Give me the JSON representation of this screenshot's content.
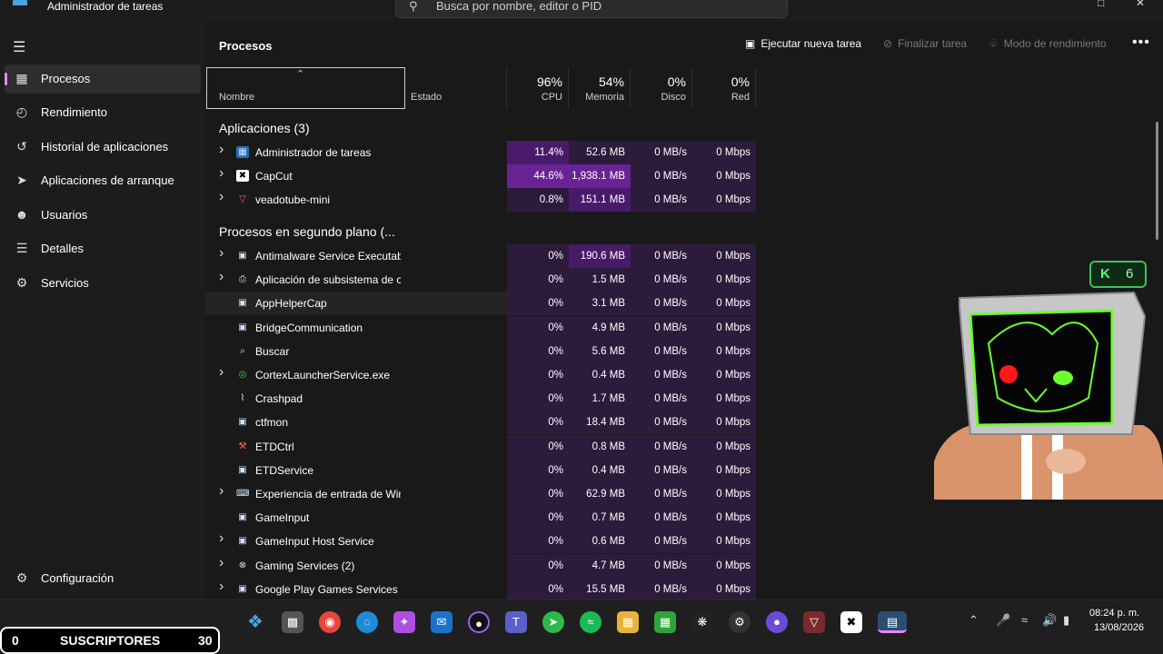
{
  "window": {
    "title": "Administrador de tareas",
    "search_placeholder": "Busca por nombre, editor o PID"
  },
  "sidebar": {
    "items": [
      {
        "label": "Procesos",
        "icon": "processes-icon"
      },
      {
        "label": "Rendimiento",
        "icon": "performance-icon"
      },
      {
        "label": "Historial de aplicaciones",
        "icon": "history-icon"
      },
      {
        "label": "Aplicaciones de arranque",
        "icon": "startup-icon"
      },
      {
        "label": "Usuarios",
        "icon": "users-icon"
      },
      {
        "label": "Detalles",
        "icon": "details-icon"
      },
      {
        "label": "Servicios",
        "icon": "services-icon"
      }
    ],
    "settings_label": "Configuración"
  },
  "toolbar": {
    "title": "Procesos",
    "run_task": "Ejecutar nueva tarea",
    "end_task": "Finalizar tarea",
    "efficiency": "Modo de rendimiento"
  },
  "columns": {
    "name": "Nombre",
    "status": "Estado",
    "cpu": {
      "pct": "96%",
      "label": "CPU"
    },
    "memory": {
      "pct": "54%",
      "label": "Memoria"
    },
    "disk": {
      "pct": "0%",
      "label": "Disco"
    },
    "network": {
      "pct": "0%",
      "label": "Red"
    }
  },
  "groups": {
    "apps": "Aplicaciones (3)",
    "background": "Procesos en segundo plano (..."
  },
  "apps": [
    {
      "name": "Administrador de tareas",
      "cpu": "11.4%",
      "mem": "52.6 MB",
      "disk": "0 MB/s",
      "net": "0 Mbps"
    },
    {
      "name": "CapCut",
      "cpu": "44.6%",
      "mem": "1,938.1 MB",
      "disk": "0 MB/s",
      "net": "0 Mbps"
    },
    {
      "name": "veadotube-mini",
      "cpu": "0.8%",
      "mem": "151.1 MB",
      "disk": "0 MB/s",
      "net": "0 Mbps"
    }
  ],
  "background": [
    {
      "name": "Antimalware Service Executable",
      "cpu": "0%",
      "mem": "190.6 MB",
      "disk": "0 MB/s",
      "net": "0 Mbps"
    },
    {
      "name": "Aplicación de subsistema de c...",
      "cpu": "0%",
      "mem": "1.5 MB",
      "disk": "0 MB/s",
      "net": "0 Mbps"
    },
    {
      "name": "AppHelperCap",
      "cpu": "0%",
      "mem": "3.1 MB",
      "disk": "0 MB/s",
      "net": "0 Mbps"
    },
    {
      "name": "BridgeCommunication",
      "cpu": "0%",
      "mem": "4.9 MB",
      "disk": "0 MB/s",
      "net": "0 Mbps"
    },
    {
      "name": "Buscar",
      "cpu": "0%",
      "mem": "5.6 MB",
      "disk": "0 MB/s",
      "net": "0 Mbps"
    },
    {
      "name": "CortexLauncherService.exe",
      "cpu": "0%",
      "mem": "0.4 MB",
      "disk": "0 MB/s",
      "net": "0 Mbps"
    },
    {
      "name": "Crashpad",
      "cpu": "0%",
      "mem": "1.7 MB",
      "disk": "0 MB/s",
      "net": "0 Mbps"
    },
    {
      "name": "ctfmon",
      "cpu": "0%",
      "mem": "18.4 MB",
      "disk": "0 MB/s",
      "net": "0 Mbps"
    },
    {
      "name": "ETDCtrl",
      "cpu": "0%",
      "mem": "0.8 MB",
      "disk": "0 MB/s",
      "net": "0 Mbps"
    },
    {
      "name": "ETDService",
      "cpu": "0%",
      "mem": "0.4 MB",
      "disk": "0 MB/s",
      "net": "0 Mbps"
    },
    {
      "name": "Experiencia de entrada de Win...",
      "cpu": "0%",
      "mem": "62.9 MB",
      "disk": "0 MB/s",
      "net": "0 Mbps"
    },
    {
      "name": "GameInput",
      "cpu": "0%",
      "mem": "0.7 MB",
      "disk": "0 MB/s",
      "net": "0 Mbps"
    },
    {
      "name": "GameInput Host Service",
      "cpu": "0%",
      "mem": "0.6 MB",
      "disk": "0 MB/s",
      "net": "0 Mbps"
    },
    {
      "name": "Gaming Services (2)",
      "cpu": "0%",
      "mem": "4.7 MB",
      "disk": "0 MB/s",
      "net": "0 Mbps"
    },
    {
      "name": "Google Play Games Services",
      "cpu": "0%",
      "mem": "15.5 MB",
      "disk": "0 MB/s",
      "net": "0 Mbps"
    }
  ],
  "overlay": {
    "badge_letter": "K",
    "badge_count": "6"
  },
  "taskbar": {
    "time": "08:24 p. m.",
    "date": "13/08/2026"
  },
  "subscribers": {
    "left": "0",
    "label": "SUSCRIPTORES",
    "right": "30"
  },
  "colors": {
    "accent": "#ec84ff",
    "heat_high": "#6a2395",
    "heat_mid": "#4a1a6a",
    "heat_low": "#2d1b3b"
  }
}
